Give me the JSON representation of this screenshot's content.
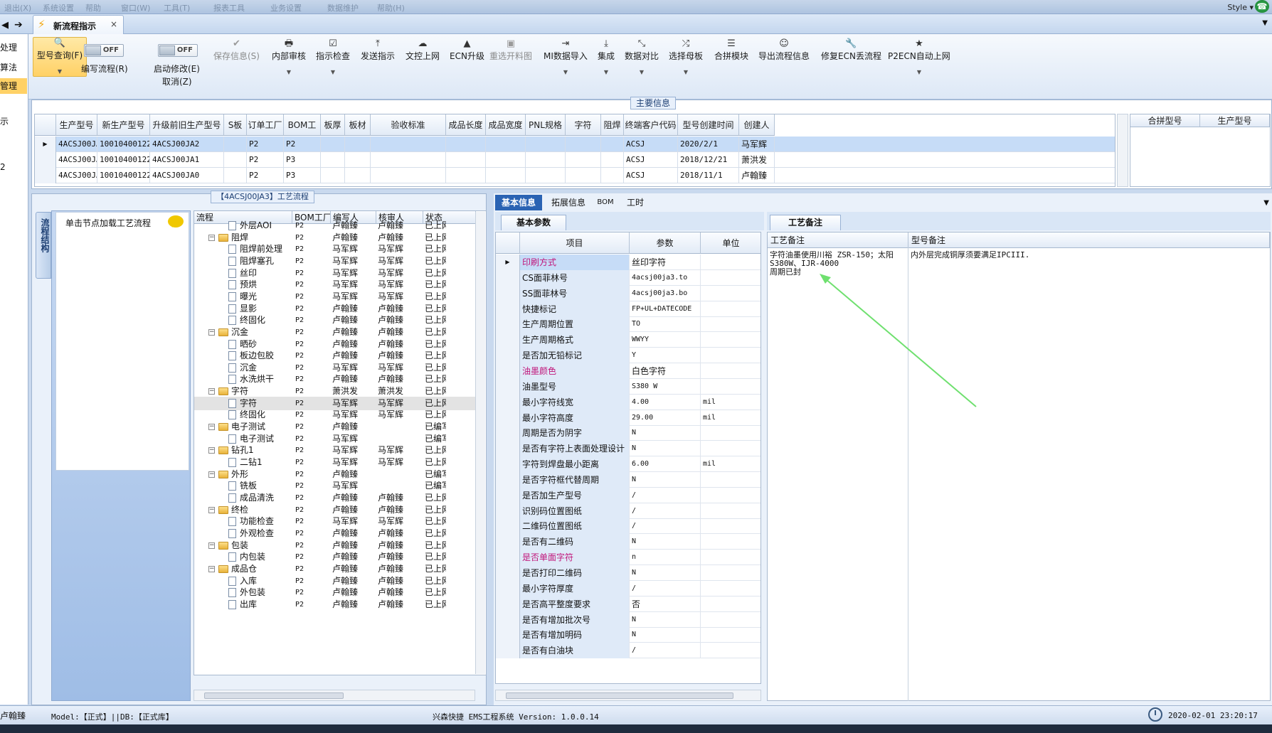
{
  "top": {
    "style_label": "Style ▾",
    "ghost_menu": [
      "退出(X)",
      "系统设置",
      "帮助",
      "窗口(W)",
      "工具(T)",
      "报表工具",
      "业务设置",
      "数据维护",
      "帮助(H)"
    ]
  },
  "tab": {
    "title": "新流程指示",
    "close": "×"
  },
  "left_nav": [
    "处理",
    "算法",
    "管理",
    "",
    "示",
    "",
    "2"
  ],
  "toolbar": {
    "model_query": "型号查询(F)",
    "toggle_off": "OFF",
    "write_flow": "编写流程(R)",
    "start_modify": "启动修改(E)",
    "cancel": "取消(Z)",
    "save_info": "保存信息(S)",
    "internal_review": "内部审核",
    "instruction_check": "指示检查",
    "send_instruction": "发送指示",
    "file_upload": "文控上网",
    "ecn_upgrade": "ECN升级",
    "reselect_material": "重选开料图",
    "mi_import": "MI数据导入",
    "integrate": "集成",
    "data_compare": "数据对比",
    "select_mother": "选择母板",
    "panel_module": "合拼模块",
    "export_flow": "导出流程信息",
    "fix_ecn": "修复ECN丢流程",
    "p2ecn_upload": "P2ECN自动上网"
  },
  "main_info": {
    "title": "主要信息",
    "columns": [
      "生产型号",
      "新生产型号",
      "升级前旧生产型号",
      "S板",
      "订单工厂",
      "BOM工厂",
      "板厚",
      "板材",
      "验收标准",
      "成品长度",
      "成品宽度",
      "PNL规格",
      "字符",
      "阻焊",
      "终端客户代码",
      "型号创建时间",
      "创建人"
    ],
    "rows": [
      [
        "4ACSJ00JA3",
        "10010400122612",
        "4ACSJ00JA2",
        "",
        "P2",
        "P2",
        "",
        "",
        "",
        "",
        "",
        "",
        "",
        "",
        "ACSJ",
        "2020/2/1",
        "马军辉"
      ],
      [
        "4ACSJ00JA2",
        "10010400122612",
        "4ACSJ00JA1",
        "",
        "P2",
        "P3",
        "",
        "",
        "",
        "",
        "",
        "",
        "",
        "",
        "ACSJ",
        "2018/12/21",
        "萧洪发"
      ],
      [
        "4ACSJ00JA1",
        "10010400122612",
        "4ACSJ00JA0",
        "",
        "P2",
        "P3",
        "",
        "",
        "",
        "",
        "",
        "",
        "",
        "",
        "ACSJ",
        "2018/11/1",
        "卢翰臻"
      ]
    ],
    "side_columns": [
      "合拼型号",
      "生产型号"
    ]
  },
  "flow": {
    "title": "【4ACSJ00JA3】工艺流程",
    "vertical_tab": "流程结构",
    "hint": "单击节点加载工艺流程",
    "columns": [
      "流程",
      "BOM工厂",
      "编写人",
      "核审人",
      "状态"
    ],
    "rows": [
      {
        "level": 2,
        "name": "外层AOI",
        "bom": "P2",
        "writer": "卢翰臻",
        "reviewer": "卢翰臻",
        "status": "已上网"
      },
      {
        "level": 1,
        "name": "阻焊",
        "bom": "P2",
        "writer": "卢翰臻",
        "reviewer": "卢翰臻",
        "status": "已上网"
      },
      {
        "level": 2,
        "name": "阻焊前处理",
        "bom": "P2",
        "writer": "马军辉",
        "reviewer": "马军辉",
        "status": "已上网"
      },
      {
        "level": 2,
        "name": "阻焊塞孔",
        "bom": "P2",
        "writer": "马军辉",
        "reviewer": "马军辉",
        "status": "已上网"
      },
      {
        "level": 2,
        "name": "丝印",
        "bom": "P2",
        "writer": "马军辉",
        "reviewer": "马军辉",
        "status": "已上网"
      },
      {
        "level": 2,
        "name": "预烘",
        "bom": "P2",
        "writer": "马军辉",
        "reviewer": "马军辉",
        "status": "已上网"
      },
      {
        "level": 2,
        "name": "曝光",
        "bom": "P2",
        "writer": "马军辉",
        "reviewer": "马军辉",
        "status": "已上网"
      },
      {
        "level": 2,
        "name": "显影",
        "bom": "P2",
        "writer": "卢翰臻",
        "reviewer": "卢翰臻",
        "status": "已上网"
      },
      {
        "level": 2,
        "name": "终固化",
        "bom": "P2",
        "writer": "卢翰臻",
        "reviewer": "卢翰臻",
        "status": "已上网"
      },
      {
        "level": 1,
        "name": "沉金",
        "bom": "P2",
        "writer": "卢翰臻",
        "reviewer": "卢翰臻",
        "status": "已上网"
      },
      {
        "level": 2,
        "name": "晒砂",
        "bom": "P2",
        "writer": "卢翰臻",
        "reviewer": "卢翰臻",
        "status": "已上网"
      },
      {
        "level": 2,
        "name": "板边包胶",
        "bom": "P2",
        "writer": "卢翰臻",
        "reviewer": "卢翰臻",
        "status": "已上网"
      },
      {
        "level": 2,
        "name": "沉金",
        "bom": "P2",
        "writer": "马军辉",
        "reviewer": "马军辉",
        "status": "已上网"
      },
      {
        "level": 2,
        "name": "水洗烘干",
        "bom": "P2",
        "writer": "卢翰臻",
        "reviewer": "卢翰臻",
        "status": "已上网"
      },
      {
        "level": 1,
        "name": "字符",
        "bom": "P2",
        "writer": "萧洪发",
        "reviewer": "萧洪发",
        "status": "已上网"
      },
      {
        "level": 2,
        "name": "字符",
        "bom": "P2",
        "writer": "马军辉",
        "reviewer": "马军辉",
        "status": "已上网",
        "selected": true
      },
      {
        "level": 2,
        "name": "终固化",
        "bom": "P2",
        "writer": "马军辉",
        "reviewer": "马军辉",
        "status": "已上网"
      },
      {
        "level": 1,
        "name": "电子测试",
        "bom": "P2",
        "writer": "卢翰臻",
        "reviewer": "",
        "status": "已编写"
      },
      {
        "level": 2,
        "name": "电子测试",
        "bom": "P2",
        "writer": "马军辉",
        "reviewer": "",
        "status": "已编写"
      },
      {
        "level": 1,
        "name": "钻孔1",
        "bom": "P2",
        "writer": "马军辉",
        "reviewer": "马军辉",
        "status": "已上网"
      },
      {
        "level": 2,
        "name": "二钻1",
        "bom": "P2",
        "writer": "马军辉",
        "reviewer": "马军辉",
        "status": "已上网"
      },
      {
        "level": 1,
        "name": "外形",
        "bom": "P2",
        "writer": "卢翰臻",
        "reviewer": "",
        "status": "已编写"
      },
      {
        "level": 2,
        "name": "铣板",
        "bom": "P2",
        "writer": "马军辉",
        "reviewer": "",
        "status": "已编写"
      },
      {
        "level": 2,
        "name": "成品清洗",
        "bom": "P2",
        "writer": "卢翰臻",
        "reviewer": "卢翰臻",
        "status": "已上网"
      },
      {
        "level": 1,
        "name": "终检",
        "bom": "P2",
        "writer": "卢翰臻",
        "reviewer": "卢翰臻",
        "status": "已上网"
      },
      {
        "level": 2,
        "name": "功能检查",
        "bom": "P2",
        "writer": "马军辉",
        "reviewer": "马军辉",
        "status": "已上网"
      },
      {
        "level": 2,
        "name": "外观检查",
        "bom": "P2",
        "writer": "卢翰臻",
        "reviewer": "卢翰臻",
        "status": "已上网"
      },
      {
        "level": 1,
        "name": "包装",
        "bom": "P2",
        "writer": "卢翰臻",
        "reviewer": "卢翰臻",
        "status": "已上网"
      },
      {
        "level": 2,
        "name": "内包装",
        "bom": "P2",
        "writer": "卢翰臻",
        "reviewer": "卢翰臻",
        "status": "已上网"
      },
      {
        "level": 1,
        "name": "成品仓",
        "bom": "P2",
        "writer": "卢翰臻",
        "reviewer": "卢翰臻",
        "status": "已上网"
      },
      {
        "level": 2,
        "name": "入库",
        "bom": "P2",
        "writer": "卢翰臻",
        "reviewer": "卢翰臻",
        "status": "已上网"
      },
      {
        "level": 2,
        "name": "外包装",
        "bom": "P2",
        "writer": "卢翰臻",
        "reviewer": "卢翰臻",
        "status": "已上网"
      },
      {
        "level": 2,
        "name": "出库",
        "bom": "P2",
        "writer": "卢翰臻",
        "reviewer": "卢翰臻",
        "status": "已上网"
      }
    ]
  },
  "detail": {
    "tabs": [
      "基本信息",
      "拓展信息",
      "BOM",
      "工时"
    ],
    "param_tab": "基本参数",
    "param_columns": [
      "项目",
      "参数",
      "单位"
    ],
    "params": [
      {
        "name": "印刷方式",
        "value": "丝印字符",
        "unit": "",
        "highlight": true,
        "selected": true
      },
      {
        "name": "CS面菲林号",
        "value": "4acsj00ja3.to",
        "unit": ""
      },
      {
        "name": "SS面菲林号",
        "value": "4acsj00ja3.bo",
        "unit": ""
      },
      {
        "name": "快捷标记",
        "value": "FP+UL+DATECODE",
        "unit": ""
      },
      {
        "name": "生产周期位置",
        "value": "TO",
        "unit": ""
      },
      {
        "name": "生产周期格式",
        "value": "WWYY",
        "unit": ""
      },
      {
        "name": "是否加无铅标记",
        "value": "Y",
        "unit": ""
      },
      {
        "name": "油墨颜色",
        "value": "白色字符",
        "unit": "",
        "highlight": true
      },
      {
        "name": "油墨型号",
        "value": "S380 W",
        "unit": ""
      },
      {
        "name": "最小字符线宽",
        "value": "4.00",
        "unit": "mil"
      },
      {
        "name": "最小字符高度",
        "value": "29.00",
        "unit": "mil"
      },
      {
        "name": "周期是否为阴字",
        "value": "N",
        "unit": ""
      },
      {
        "name": "是否有字符上表面处理设计",
        "value": "N",
        "unit": ""
      },
      {
        "name": "字符到焊盘最小距离",
        "value": "6.00",
        "unit": "mil"
      },
      {
        "name": "是否字符框代替周期",
        "value": "N",
        "unit": ""
      },
      {
        "name": "是否加生产型号",
        "value": "/",
        "unit": ""
      },
      {
        "name": "识别码位置图纸",
        "value": "/",
        "unit": ""
      },
      {
        "name": "二维码位置图纸",
        "value": "/",
        "unit": ""
      },
      {
        "name": "是否有二维码",
        "value": "N",
        "unit": ""
      },
      {
        "name": "是否单面字符",
        "value": "n",
        "unit": "",
        "highlight": true
      },
      {
        "name": "是否打印二维码",
        "value": "N",
        "unit": ""
      },
      {
        "name": "最小字符厚度",
        "value": "/",
        "unit": ""
      },
      {
        "name": "是否高平整度要求",
        "value": "否",
        "unit": ""
      },
      {
        "name": "是否有增加批次号",
        "value": "N",
        "unit": ""
      },
      {
        "name": "是否有增加明码",
        "value": "N",
        "unit": ""
      },
      {
        "name": "是否有白油块",
        "value": "/",
        "unit": ""
      }
    ],
    "remark_tab": "工艺备注",
    "remark_columns": [
      "工艺备注",
      "型号备注"
    ],
    "process_remark": "字符油墨使用川裕 ZSR-150；太阳S380W、IJR-4000\n周期已封",
    "model_remark": "内外层完成铜厚须要满足IPCIII."
  },
  "status": {
    "user": "卢翰臻",
    "model": "Model:【正式】||DB:【正式库】",
    "app": "兴森快捷 EMS工程系统 Version: 1.0.0.14",
    "time": "2020-02-01 23:20:17"
  },
  "colors": {
    "accent_tab": "#2a63b3",
    "selected_row": "#c6dcf7",
    "highlight_text": "#c0157a",
    "annotation_arrow": "#6fe06f"
  }
}
